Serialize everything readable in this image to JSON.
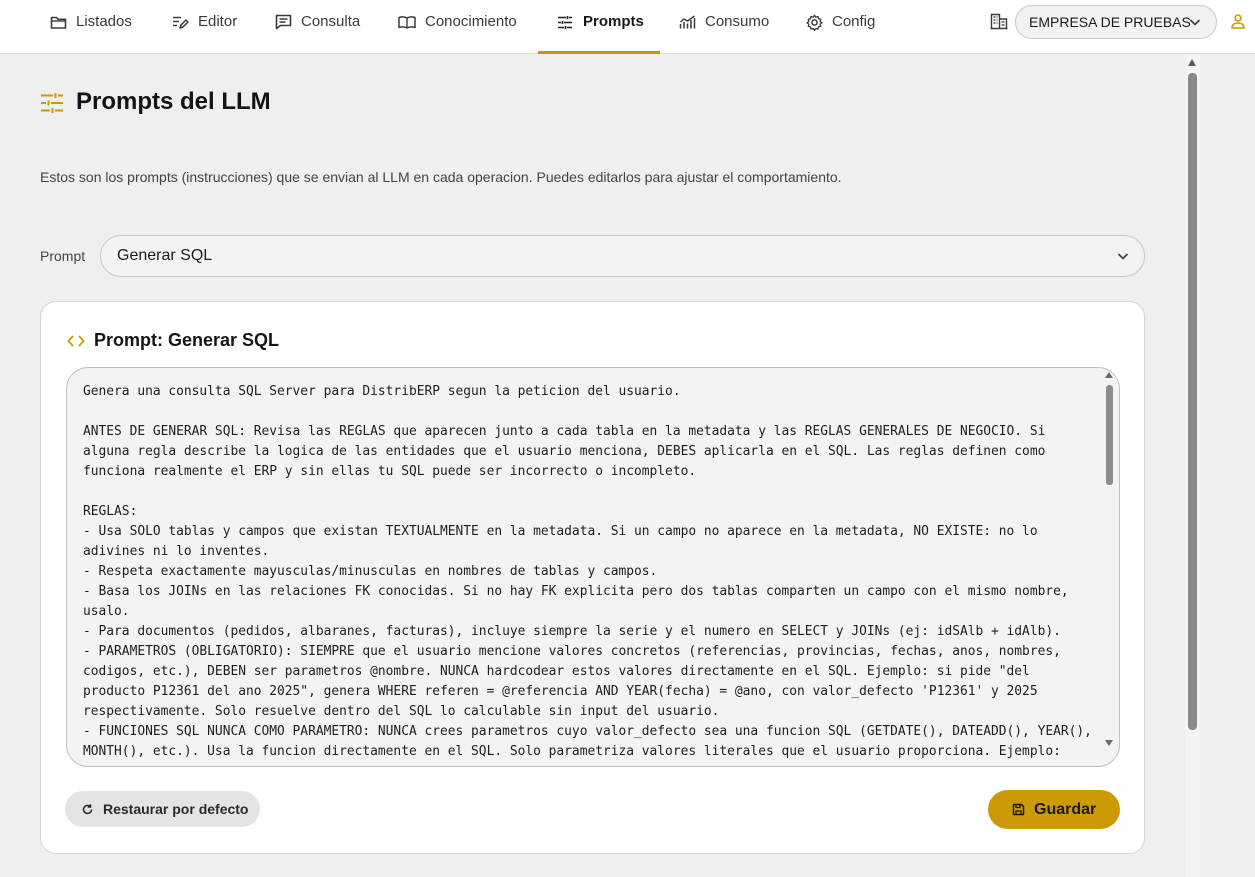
{
  "nav": {
    "tabs": [
      {
        "label": "Listados",
        "icon": "folder-icon"
      },
      {
        "label": "Editor",
        "icon": "edit-icon"
      },
      {
        "label": "Consulta",
        "icon": "chat-icon"
      },
      {
        "label": "Conocimiento",
        "icon": "book-icon"
      },
      {
        "label": "Prompts",
        "icon": "tune-icon"
      },
      {
        "label": "Consumo",
        "icon": "chart-icon"
      },
      {
        "label": "Config",
        "icon": "gear-icon"
      }
    ],
    "active_tab": "Prompts",
    "company": "EMPRESA DE PRUEBAS"
  },
  "page": {
    "title": "Prompts del LLM",
    "description": "Estos son los prompts (instrucciones) que se envian al LLM en cada operacion. Puedes editarlos para ajustar el comportamiento.",
    "prompt_label": "Prompt",
    "prompt_selected": "Generar SQL"
  },
  "card": {
    "title": "Prompt: Generar SQL",
    "prompt_text": "Genera una consulta SQL Server para DistribERP segun la peticion del usuario.\n\nANTES DE GENERAR SQL: Revisa las REGLAS que aparecen junto a cada tabla en la metadata y las REGLAS GENERALES DE NEGOCIO. Si alguna regla describe la logica de las entidades que el usuario menciona, DEBES aplicarla en el SQL. Las reglas definen como funciona realmente el ERP y sin ellas tu SQL puede ser incorrecto o incompleto.\n\nREGLAS:\n- Usa SOLO tablas y campos que existan TEXTUALMENTE en la metadata. Si un campo no aparece en la metadata, NO EXISTE: no lo adivines ni lo inventes.\n- Respeta exactamente mayusculas/minusculas en nombres de tablas y campos.\n- Basa los JOINs en las relaciones FK conocidas. Si no hay FK explicita pero dos tablas comparten un campo con el mismo nombre, usalo.\n- Para documentos (pedidos, albaranes, facturas), incluye siempre la serie y el numero en SELECT y JOINs (ej: idSAlb + idAlb).\n- PARAMETROS (OBLIGATORIO): SIEMPRE que el usuario mencione valores concretos (referencias, provincias, fechas, anos, nombres, codigos, etc.), DEBEN ser parametros @nombre. NUNCA hardcodear estos valores directamente en el SQL. Ejemplo: si pide \"del producto P12361 del ano 2025\", genera WHERE referen = @referencia AND YEAR(fecha) = @ano, con valor_defecto 'P12361' y 2025 respectivamente. Solo resuelve dentro del SQL lo calculable sin input del usuario.\n- FUNCIONES SQL NUNCA COMO PARAMETRO: NUNCA crees parametros cuyo valor_defecto sea una funcion SQL (GETDATE(), DATEADD(), YEAR(), MONTH(), etc.). Usa la funcion directamente en el SQL. Solo parametriza valores literales que el usuario proporciona. Ejemplo:",
    "reset_label": "Restaurar por defecto",
    "save_label": "Guardar"
  },
  "colors": {
    "accent": "#cc9a06",
    "background": "#efefef",
    "card": "#ffffff"
  }
}
